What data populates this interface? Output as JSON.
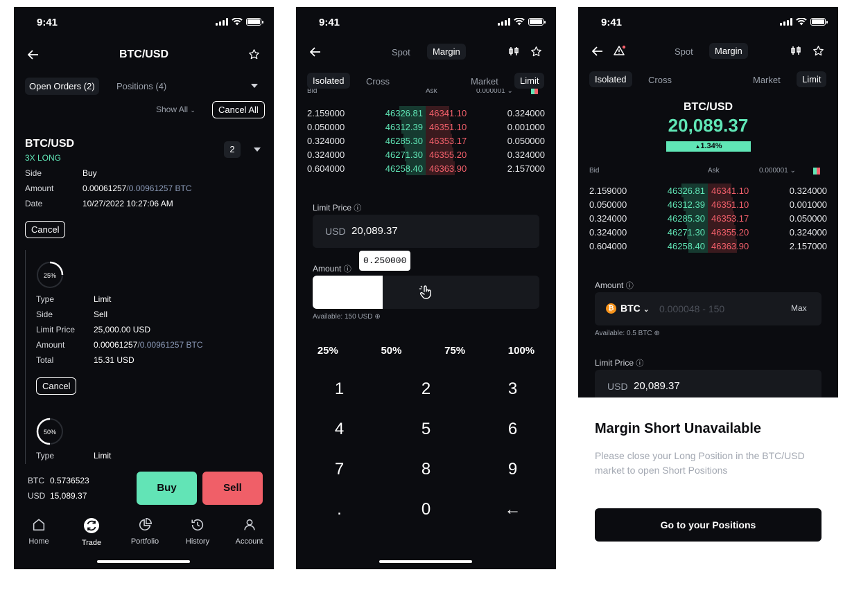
{
  "status": {
    "time": "9:41"
  },
  "screen1": {
    "title": "BTC/USD",
    "tabs": {
      "open_orders": "Open Orders (2)",
      "positions": "Positions (4)"
    },
    "show_all": "Show All",
    "cancel_all": "Cancel All",
    "order": {
      "pair": "BTC/USD",
      "leverage": "3X LONG",
      "count": "2",
      "side_label": "Side",
      "side_value": "Buy",
      "amount_label": "Amount",
      "amount_a": "0.00061257",
      "amount_b": "0.00961257 BTC",
      "date_label": "Date",
      "date_value": "10/27/2022 10:27:06 AM",
      "cancel": "Cancel"
    },
    "sub1": {
      "progress_label": "25%",
      "progress": 0.25,
      "type_label": "Type",
      "type_value": "Limit",
      "side_label": "Side",
      "side_value": "Sell",
      "limit_label": "Limit Price",
      "limit_value": "25,000.00 USD",
      "amount_label": "Amount",
      "amount_a": "0.00061257",
      "amount_b": "0.00961257 BTC",
      "total_label": "Total",
      "total_value": "15.31 USD",
      "cancel": "Cancel"
    },
    "sub2": {
      "progress_label": "50%",
      "progress": 0.5,
      "type_label": "Type",
      "type_value": "Limit"
    },
    "balance": {
      "btc_label": "BTC",
      "btc_value": "0.5736523",
      "usd_label": "USD",
      "usd_value": "15,089.37"
    },
    "buy": "Buy",
    "sell": "Sell",
    "nav": [
      {
        "label": "Home"
      },
      {
        "label": "Trade"
      },
      {
        "label": "Portfolio"
      },
      {
        "label": "History"
      },
      {
        "label": "Account"
      }
    ]
  },
  "screen2": {
    "tabs": {
      "spot": "Spot",
      "margin": "Margin"
    },
    "mode": {
      "isolated": "Isolated",
      "cross": "Cross",
      "market": "Market",
      "limit": "Limit"
    },
    "ob_head": {
      "bid": "Bid",
      "ask": "Ask",
      "precision": "0.000001"
    },
    "limit_label": "Limit Price",
    "currency": "USD",
    "limit_value": "20,089.37",
    "amount_label": "Amount",
    "tooltip": "0.250000",
    "slider_fill": 0.25,
    "available": "Available: 150 USD",
    "percents": [
      "25%",
      "50%",
      "75%",
      "100%"
    ],
    "keys": [
      "1",
      "2",
      "3",
      "4",
      "5",
      "6",
      "7",
      "8",
      "9",
      ".",
      "0",
      "←"
    ]
  },
  "orderbook": [
    {
      "bid_amt": "2.159000",
      "bid": "46326.81",
      "ask": "46341.10",
      "ask_amt": "0.324000"
    },
    {
      "bid_amt": "0.050000",
      "bid": "46312.39",
      "ask": "46351.10",
      "ask_amt": "0.001000"
    },
    {
      "bid_amt": "0.324000",
      "bid": "46285.30",
      "ask": "46353.17",
      "ask_amt": "0.050000"
    },
    {
      "bid_amt": "0.324000",
      "bid": "46271.30",
      "ask": "46355.20",
      "ask_amt": "0.324000"
    },
    {
      "bid_amt": "0.604000",
      "bid": "46258.40",
      "ask": "46363.90",
      "ask_amt": "2.157000"
    }
  ],
  "screen3": {
    "tabs": {
      "spot": "Spot",
      "margin": "Margin"
    },
    "mode": {
      "isolated": "Isolated",
      "cross": "Cross",
      "market": "Market",
      "limit": "Limit"
    },
    "pair": "BTC/USD",
    "price": "20,089.37",
    "change": "1.34%",
    "ob_head": {
      "bid": "Bid",
      "ask": "Ask",
      "precision": "0.000001"
    },
    "amount_label": "Amount",
    "coin": "BTC",
    "amount_placeholder": "0.000048 - 150",
    "max": "Max",
    "available": "Available: 0.5 BTC",
    "limit_label": "Limit Price",
    "currency": "USD",
    "limit_value": "20,089.37",
    "sheet": {
      "title": "Margin Short Unavailable",
      "body_line1": "Please close your Long Position in the BTC/USD",
      "body_line2": "market to open Short Positions",
      "button": "Go to your Positions"
    }
  },
  "colors": {
    "bg": "#0b0c10",
    "green": "#60e6b6",
    "red": "#f3606b",
    "buy_btn": "#62e4b6",
    "sell_btn": "#f05f68"
  }
}
